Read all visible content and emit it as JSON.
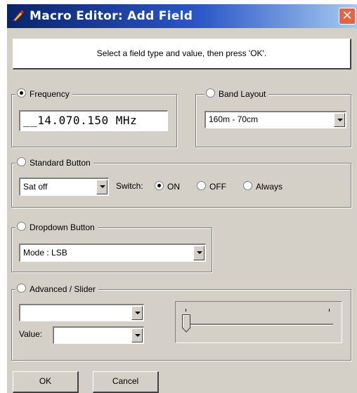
{
  "window": {
    "title": "Macro Editor: Add Field",
    "close_glyph": "✕",
    "instruction": "Select a field type and value, then press 'OK'."
  },
  "frequency": {
    "label": "Frequency",
    "selected": true,
    "value": "__14.070.150 MHz"
  },
  "band_layout": {
    "label": "Band Layout",
    "selected": false,
    "value": "160m - 70cm"
  },
  "standard_button": {
    "label": "Standard Button",
    "selected": false,
    "value": "Sat off",
    "switch_label": "Switch:",
    "switch_options": [
      "ON",
      "OFF",
      "Always"
    ],
    "switch_selected": "ON"
  },
  "dropdown_button": {
    "label": "Dropdown Button",
    "selected": false,
    "value": "Mode : LSB"
  },
  "advanced": {
    "label": "Advanced / Slider",
    "selected": false,
    "combo_value": "",
    "value_label": "Value:",
    "value_value": "",
    "slider_level": 0
  },
  "buttons": {
    "ok": "OK",
    "cancel": "Cancel"
  },
  "icons": {
    "title_icon": "wrench-pencil-icon",
    "close": "close-icon",
    "dropdown": "chevron-down-icon"
  },
  "colors": {
    "title_bar": "#0a246a",
    "close_button": "#e7623f",
    "dialog_face": "#d4d0c8"
  }
}
